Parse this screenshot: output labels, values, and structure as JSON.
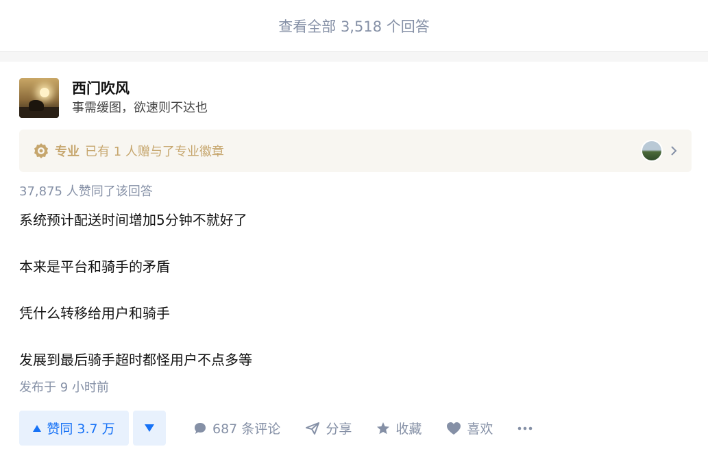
{
  "top": {
    "view_all": "查看全部 3,518 个回答"
  },
  "author": {
    "name": "西门吹风",
    "headline": "事需缓图，欲速则不达也"
  },
  "badge": {
    "title": "专业",
    "description": "已有 1 人赠与了专业徽章",
    "color": "#c6a66d"
  },
  "answer": {
    "voters_text": "37,875 人赞同了该回答",
    "paragraphs": [
      "系统预计配送时间增加5分钟不就好了",
      "本来是平台和骑手的矛盾",
      "凭什么转移给用户和骑手",
      "发展到最后骑手超时都怪用户不点多等"
    ],
    "published": "发布于 9 小时前"
  },
  "actions": {
    "upvote": "赞同 3.7 万",
    "comments": "687 条评论",
    "share": "分享",
    "favorite": "收藏",
    "like": "喜欢",
    "accent": "#1772f6"
  },
  "icons": [
    "badge-icon",
    "chevron-right-icon",
    "caret-up-icon",
    "caret-down-icon",
    "comment-icon",
    "share-icon",
    "star-icon",
    "heart-icon",
    "more-icon"
  ]
}
